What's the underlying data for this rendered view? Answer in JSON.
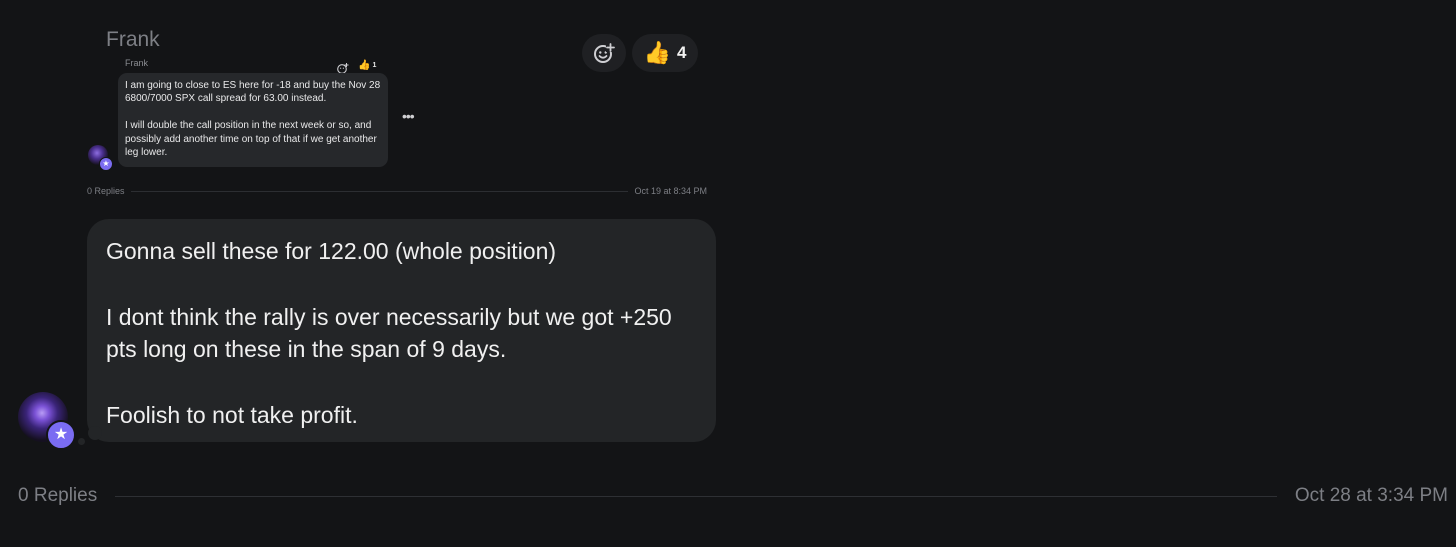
{
  "message": {
    "author": "Frank",
    "reactions": {
      "add_icon": "add-reaction-icon",
      "thumbs_emoji": "👍",
      "thumbs_count": "4"
    },
    "quoted": {
      "author": "Frank",
      "thumbs_emoji": "👍",
      "thumbs_count": "1",
      "text": "I am going to close to ES here for -18 and buy the Nov 28 6800/7000 SPX call spread for 63.00 instead.\n\nI will double the call position in the next week or so, and possibly add another time on top of that if we get another leg lower.",
      "more": "•••",
      "replies": "0 Replies",
      "timestamp": "Oct 19 at 8:34 PM"
    },
    "body": "Gonna sell these for 122.00 (whole position)\n\nI dont think the rally is over necessarily but we got +250 pts long on these in the span of 9 days.\n\nFoolish to not take profit.",
    "replies": "0 Replies",
    "timestamp": "Oct 28 at 3:34 PM",
    "badge_glyph": "★"
  },
  "colors": {
    "background": "#131416",
    "bubble": "#232527",
    "badge": "#7a6cf2",
    "muted_text": "#7d7f85"
  }
}
